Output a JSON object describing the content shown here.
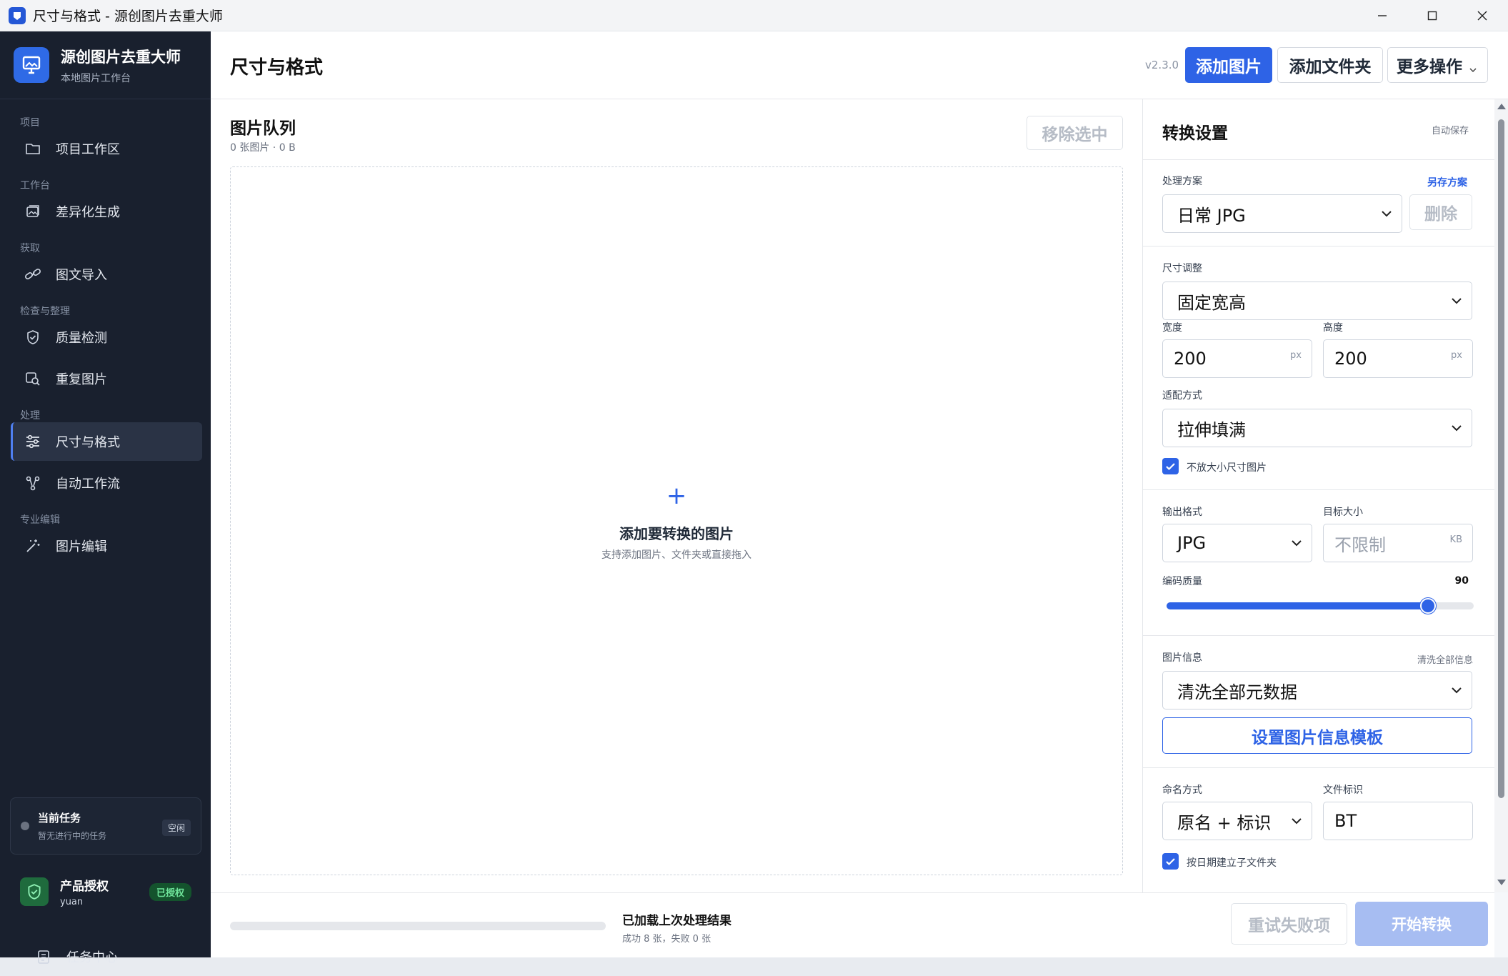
{
  "window": {
    "title": "尺寸与格式 - 源创图片去重大师"
  },
  "brand": {
    "name": "源创图片去重大师",
    "subtitle": "本地图片工作台"
  },
  "sidebar": {
    "sections": [
      {
        "label": "项目",
        "items": [
          {
            "label": "项目工作区",
            "icon": "folder-icon"
          }
        ]
      },
      {
        "label": "工作台",
        "items": [
          {
            "label": "差异化生成",
            "icon": "image-icon"
          }
        ]
      },
      {
        "label": "获取",
        "items": [
          {
            "label": "图文导入",
            "icon": "link-icon"
          }
        ]
      },
      {
        "label": "检查与整理",
        "items": [
          {
            "label": "质量检测",
            "icon": "shield-icon"
          },
          {
            "label": "重复图片",
            "icon": "search-image-icon"
          }
        ]
      },
      {
        "label": "处理",
        "items": [
          {
            "label": "尺寸与格式",
            "icon": "sliders-icon",
            "active": true
          },
          {
            "label": "自动工作流",
            "icon": "workflow-icon"
          }
        ]
      },
      {
        "label": "专业编辑",
        "items": [
          {
            "label": "图片编辑",
            "icon": "magic-wand-icon"
          }
        ]
      }
    ],
    "current_task": {
      "title": "当前任务",
      "subtitle": "暂无进行中的任务",
      "badge": "空闲"
    },
    "license": {
      "title": "产品授权",
      "user": "yuan",
      "badge": "已授权"
    },
    "task_center": "任务中心"
  },
  "header": {
    "title": "尺寸与格式",
    "version": "v2.3.0",
    "add_image": "添加图片",
    "add_folder": "添加文件夹",
    "more": "更多操作"
  },
  "queue": {
    "title": "图片队列",
    "summary": "0 张图片 · 0 B",
    "remove_selected": "移除选中",
    "drop_plus": "+",
    "drop_title": "添加要转换的图片",
    "drop_hint": "支持添加图片、文件夹或直接拖入"
  },
  "settings": {
    "title": "转换设置",
    "autosave": "自动保存",
    "preset_label": "处理方案",
    "save_as": "另存方案",
    "preset_value": "日常 JPG",
    "delete": "删除",
    "resize_label": "尺寸调整",
    "resize_value": "固定宽高",
    "width_label": "宽度",
    "width_value": "200",
    "height_label": "高度",
    "height_value": "200",
    "unit_px": "px",
    "fit_label": "适配方式",
    "fit_value": "拉伸填满",
    "no_upscale": "不放大小尺寸图片",
    "no_upscale_checked": true,
    "format_label": "输出格式",
    "format_value": "JPG",
    "target_size_label": "目标大小",
    "target_size_placeholder": "不限制",
    "unit_kb": "KB",
    "quality_label": "编码质量",
    "quality_value": "90",
    "quality_fraction": 0.85,
    "meta_label": "图片信息",
    "meta_hint": "清洗全部信息",
    "meta_value": "清洗全部元数据",
    "meta_template": "设置图片信息模板",
    "naming_label": "命名方式",
    "naming_value": "原名 + 标识",
    "tag_label": "文件标识",
    "tag_value": "BT",
    "date_folder": "按日期建立子文件夹",
    "date_folder_checked": true
  },
  "footer": {
    "status_title": "已加载上次处理结果",
    "status_detail": "成功 8 张，失败 0 张",
    "progress": 0,
    "retry": "重试失败项",
    "start": "开始转换"
  },
  "colors": {
    "accent": "#2e63e6",
    "sidebar_bg": "#19202e",
    "success": "#6ee39a"
  }
}
